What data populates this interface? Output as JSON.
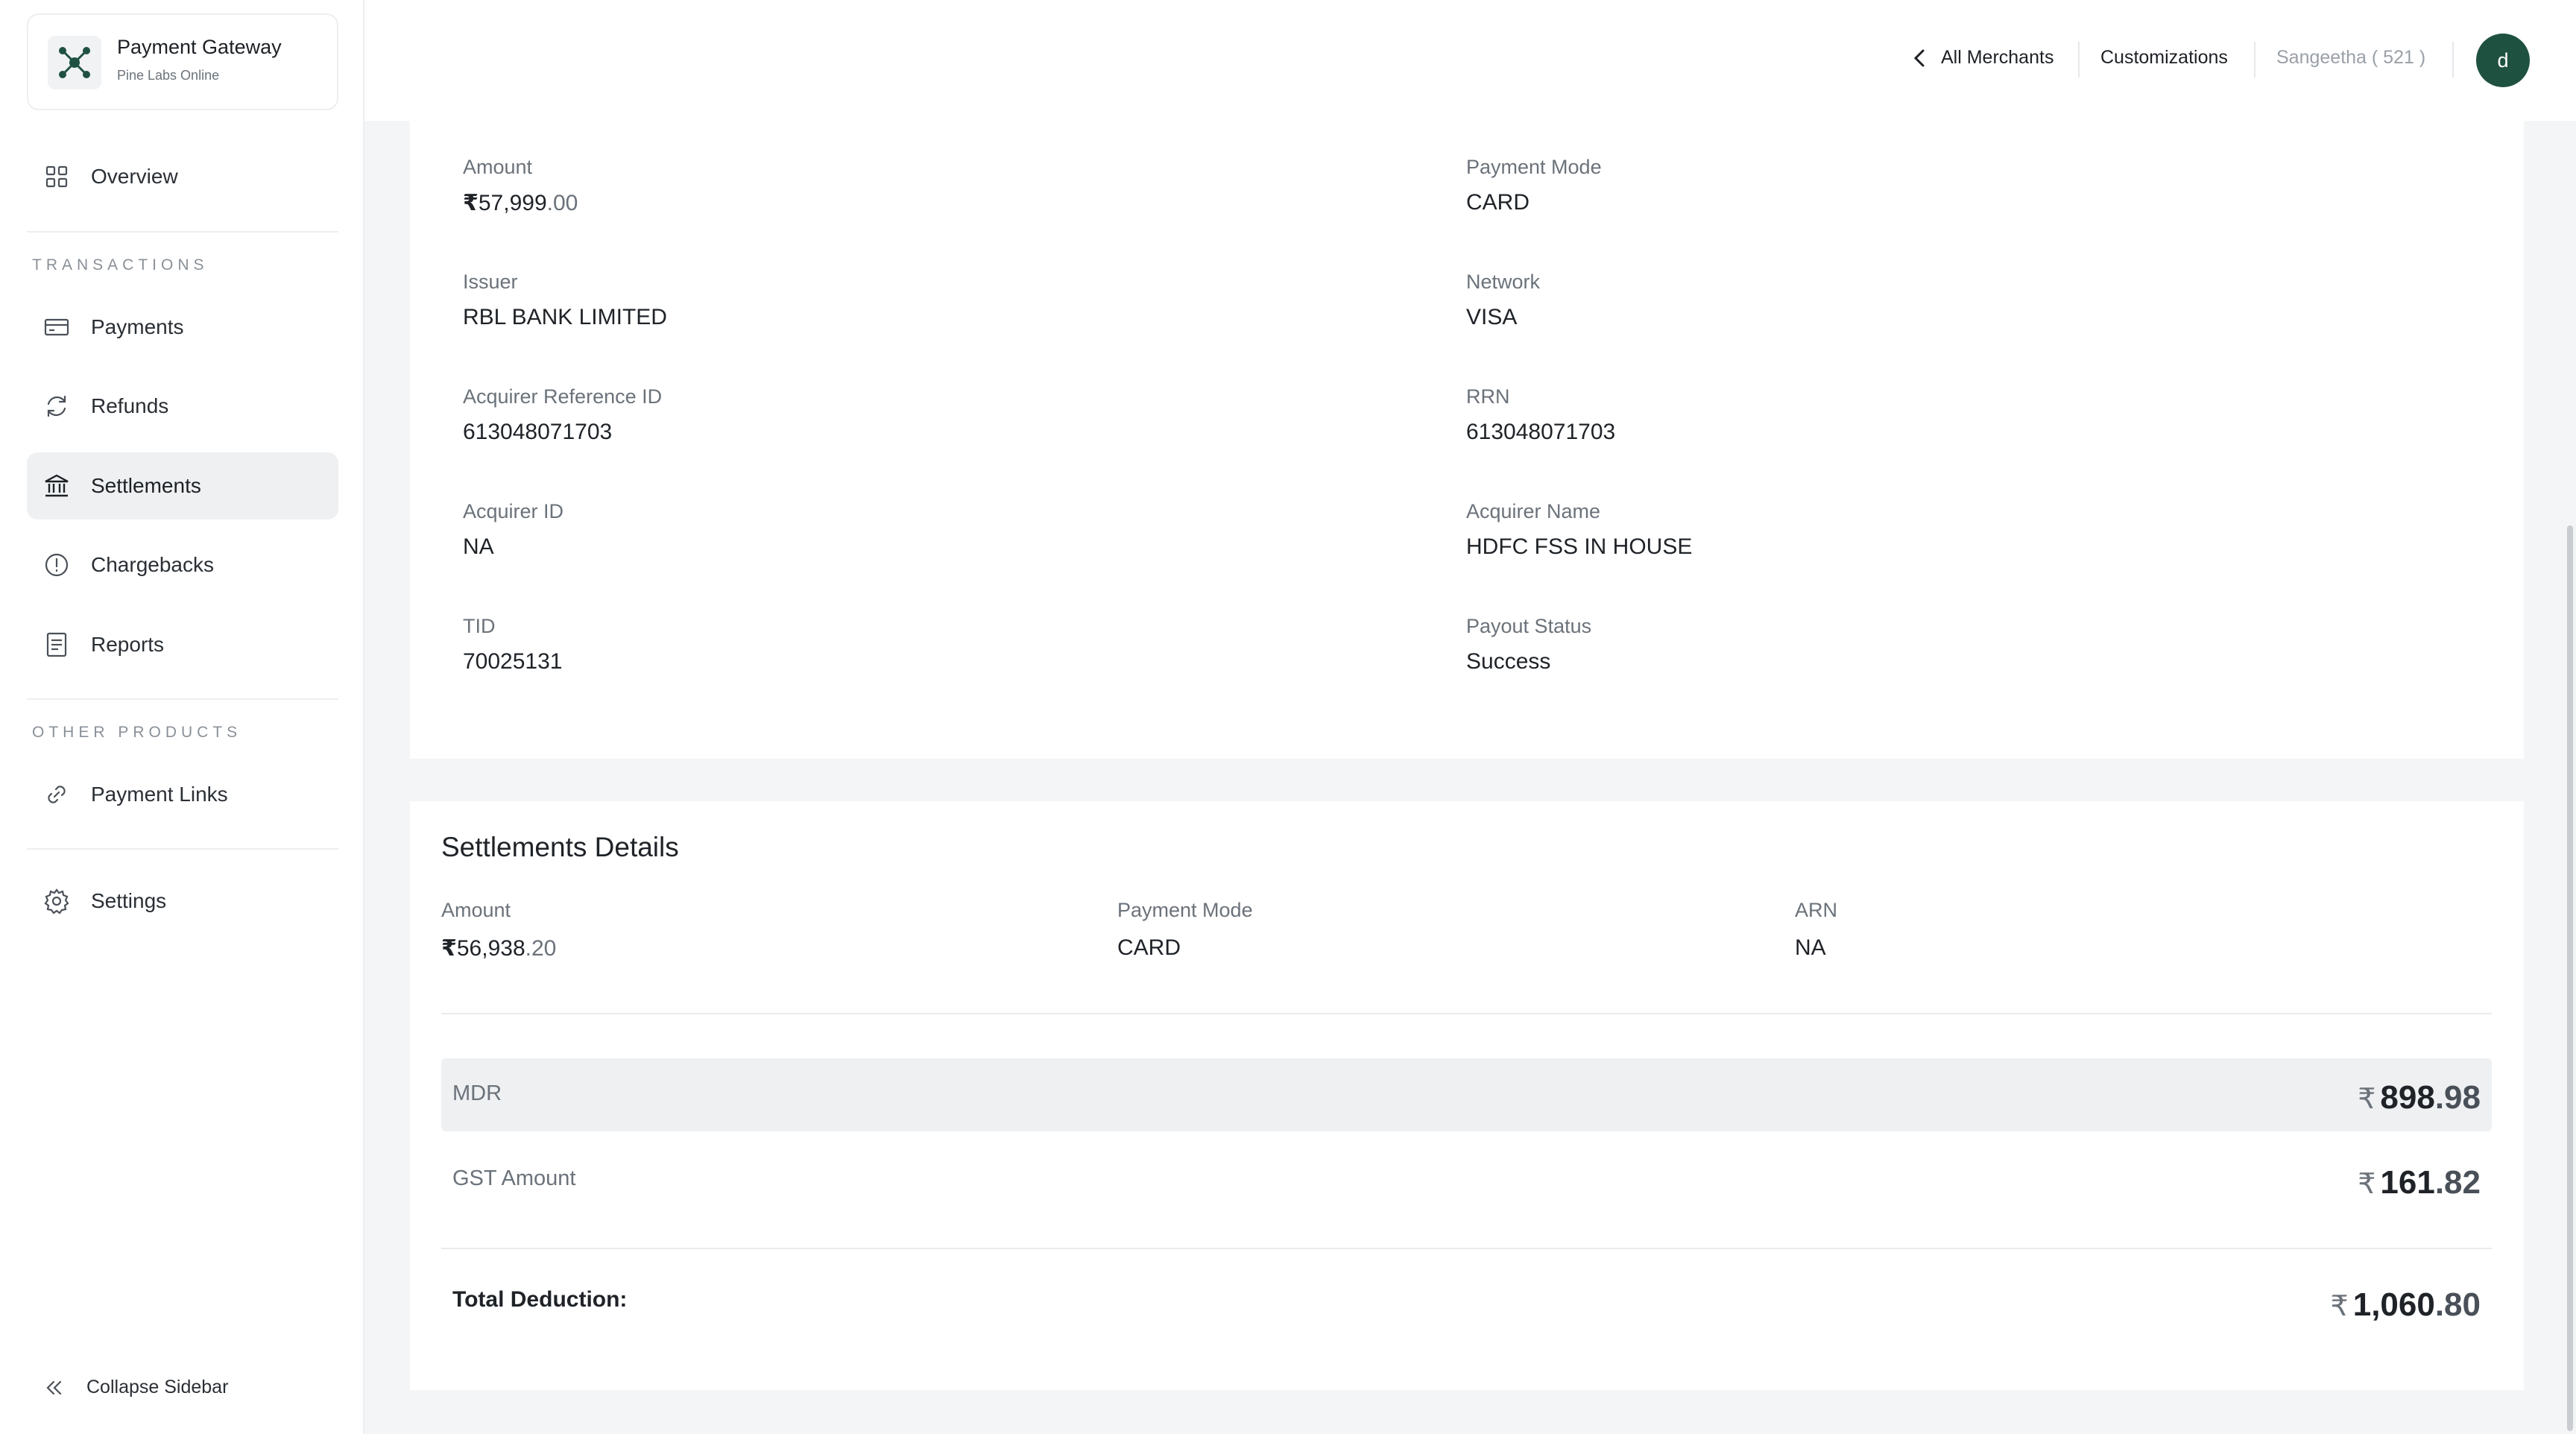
{
  "brand": {
    "title": "Payment Gateway",
    "subtitle": "Pine Labs Online"
  },
  "sidebar": {
    "overview": "Overview",
    "section_transactions": "TRANSACTIONS",
    "payments": "Payments",
    "refunds": "Refunds",
    "settlements": "Settlements",
    "chargebacks": "Chargebacks",
    "reports": "Reports",
    "section_other": "OTHER PRODUCTS",
    "payment_links": "Payment Links",
    "settings": "Settings",
    "collapse": "Collapse Sidebar",
    "active_item": "Settlements"
  },
  "header": {
    "all_merchants": "All Merchants",
    "customizations": "Customizations",
    "user": "Sangeetha ( 521 )",
    "avatar_initial": "d"
  },
  "transaction": {
    "amount_label": "Amount",
    "amount_symbol": "₹",
    "amount_int": "57,999",
    "amount_dec": ".00",
    "payment_mode_label": "Payment Mode",
    "payment_mode": "CARD",
    "issuer_label": "Issuer",
    "issuer": "RBL BANK LIMITED",
    "network_label": "Network",
    "network": "VISA",
    "acq_ref_label": "Acquirer Reference ID",
    "acq_ref": "613048071703",
    "rrn_label": "RRN",
    "rrn": "613048071703",
    "acq_id_label": "Acquirer ID",
    "acq_id": "NA",
    "acq_name_label": "Acquirer Name",
    "acq_name": "HDFC FSS IN HOUSE",
    "tid_label": "TID",
    "tid": "70025131",
    "payout_label": "Payout Status",
    "payout": "Success"
  },
  "settlement": {
    "title": "Settlements Details",
    "amount_label": "Amount",
    "amount_symbol": "₹",
    "amount_int": "56,938",
    "amount_dec": ".20",
    "payment_mode_label": "Payment Mode",
    "payment_mode": "CARD",
    "arn_label": "ARN",
    "arn": "NA",
    "currency": "₹",
    "mdr_label": "MDR",
    "mdr_int": "898",
    "mdr_dec": ".98",
    "gst_label": "GST Amount",
    "gst_int": "161",
    "gst_dec": ".82",
    "total_label": "Total Deduction:",
    "total_int": "1,060",
    "total_dec": ".80"
  },
  "icons": {
    "brand": "network-nodes-icon",
    "overview": "grid-icon",
    "payments": "card-icon",
    "refunds": "refresh-icon",
    "settlements": "bank-icon",
    "chargebacks": "alert-circle-icon",
    "reports": "document-icon",
    "payment_links": "link-icon",
    "settings": "gear-icon",
    "collapse": "double-chevron-left-icon",
    "back": "chevron-left-icon"
  },
  "colors": {
    "brand_green": "#1f5141",
    "active_bg": "#eef0f2"
  }
}
